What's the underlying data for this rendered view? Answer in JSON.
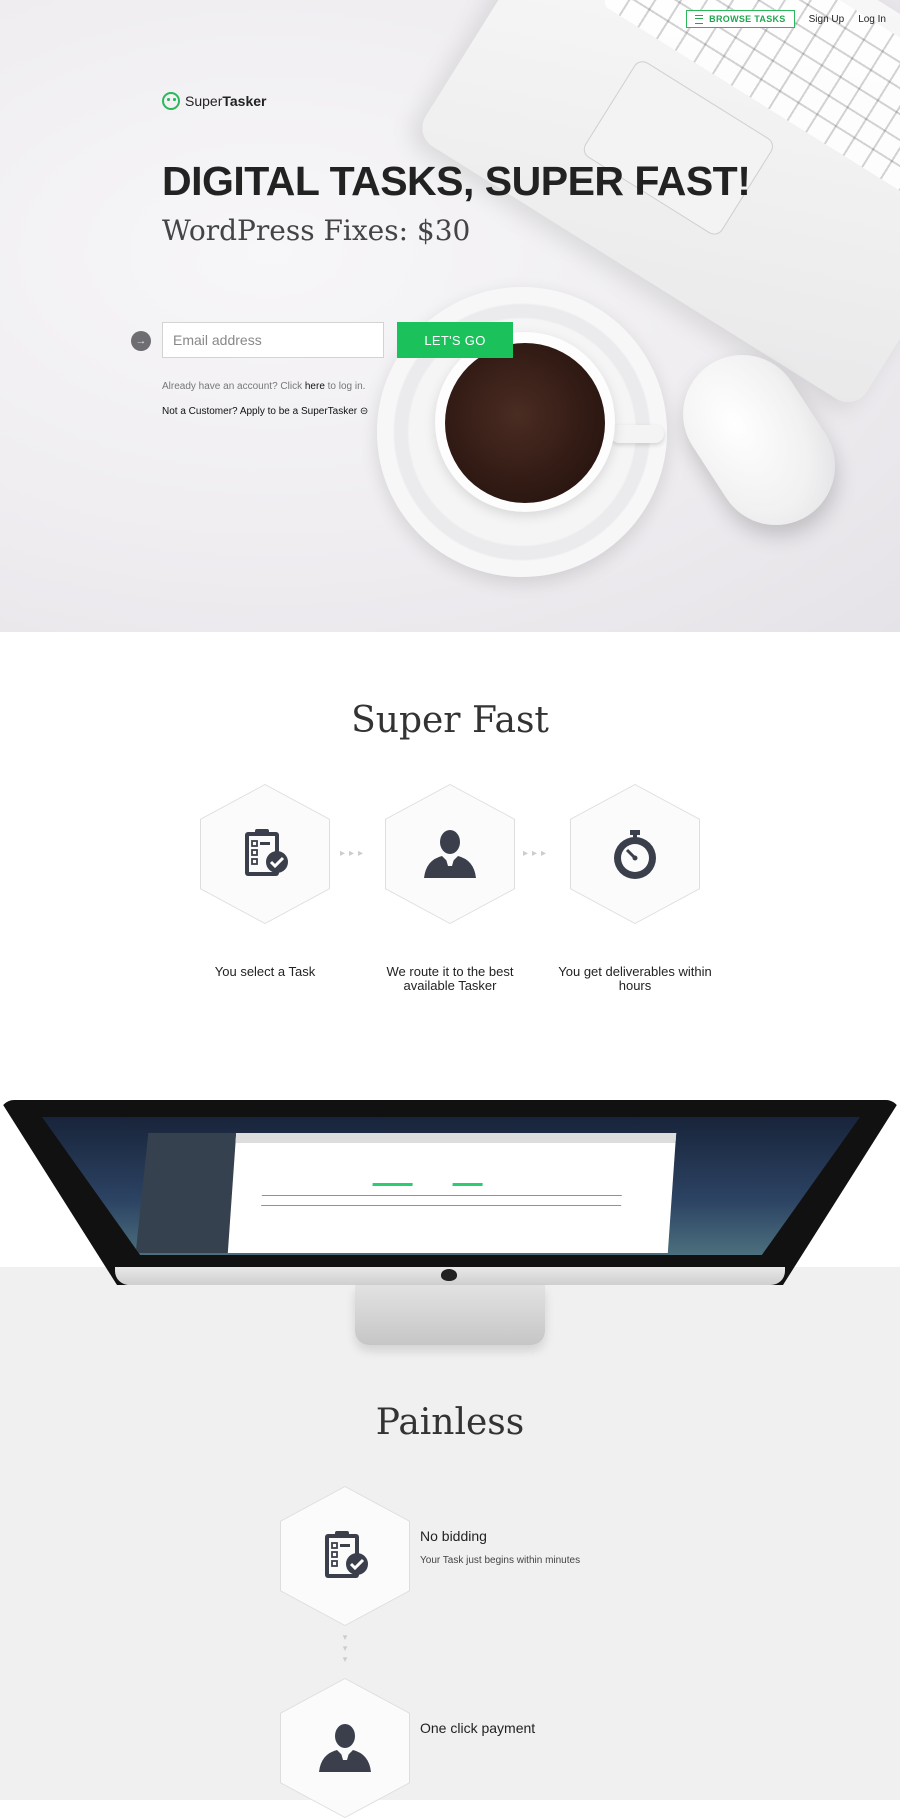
{
  "nav": {
    "browse_label": "BROWSE TASKS",
    "signup_label": "Sign Up",
    "login_label": "Log In"
  },
  "brand": {
    "name_light": "Super",
    "name_bold": "Tasker",
    "accent_color": "#1bc25c"
  },
  "hero": {
    "title": "DIGITAL TASKS, SUPER FAST!",
    "subtitle": "WordPress Fixes: $30",
    "email_placeholder": "Email address",
    "cta_label": "LET'S GO",
    "login_prefix": "Already have an account? Click",
    "login_link": "here",
    "login_suffix": "to log in.",
    "apply_text": "Not a Customer? Apply to be a SuperTasker ⊝"
  },
  "super_fast": {
    "title": "Super Fast",
    "steps": [
      {
        "icon": "clipboard-check-icon",
        "label": "You select a Task"
      },
      {
        "icon": "person-icon",
        "label": "We route it to the best available Tasker"
      },
      {
        "icon": "stopwatch-icon",
        "label": "You get deliverables within hours"
      }
    ]
  },
  "painless": {
    "title": "Painless",
    "features": [
      {
        "icon": "clipboard-check-icon",
        "title": "No bidding",
        "desc": "Your Task just begins within minutes"
      },
      {
        "icon": "person-icon",
        "title": "One click payment",
        "desc": ""
      }
    ]
  }
}
